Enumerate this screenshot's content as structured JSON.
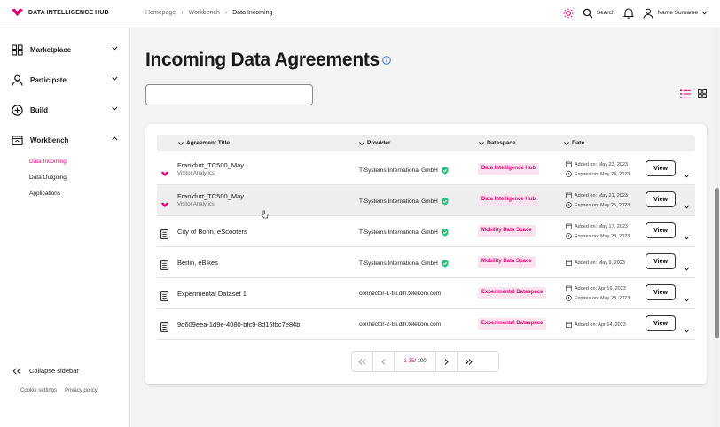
{
  "app": {
    "logo_text": "DATA INTELLIGENCE HUB",
    "accent": "#e20074"
  },
  "breadcrumb": [
    "Homepage",
    "Workbench",
    "Data Incoming"
  ],
  "topbar": {
    "search_label": "Search",
    "user_name": "Name Surname"
  },
  "sidebar": {
    "items": [
      {
        "label": "Marketplace",
        "icon": "grid-icon"
      },
      {
        "label": "Participate",
        "icon": "user-icon"
      },
      {
        "label": "Build",
        "icon": "plus-circle-icon"
      },
      {
        "label": "Workbench",
        "icon": "workbench-icon"
      }
    ],
    "subitems": [
      "Data Incoming",
      "Data Outgoing",
      "Applications"
    ],
    "collapse_label": "Collapse sidebar",
    "footer_links": [
      "Cookie settings",
      "Privacy policy"
    ]
  },
  "page": {
    "title": "Incoming Data Agreements",
    "search_value": ""
  },
  "table": {
    "headers": [
      "Agreement Title",
      "Provider",
      "Dataspace",
      "Date"
    ],
    "view_label": "View",
    "rows": [
      {
        "title": "Frankfurt_TC500_May",
        "subtitle": "Visitor Analytics",
        "provider": "T-Systems International GmbH",
        "verified": true,
        "dataspace": "Data Intelligence Hub",
        "added": "Added on: May 23, 2023",
        "expires": "Expires on: May 24, 2023",
        "icon": "dih-logo-icon"
      },
      {
        "title": "Frankfurt_TC500_May",
        "subtitle": "Visitor Analytics",
        "provider": "T-Systems International GmbH",
        "verified": true,
        "dataspace": "Data Intelligence Hub",
        "added": "Added on: May 21, 2023",
        "expires": "Expires on: May 25, 2023",
        "icon": "dih-logo-icon"
      },
      {
        "title": "City of Bonn, eScooters",
        "subtitle": "",
        "provider": "T-Systems International GmbH",
        "verified": true,
        "dataspace": "Mobility Data Space",
        "added": "Added on: May 17, 2023",
        "expires": "Expires on: May 23, 2023",
        "icon": "document-icon"
      },
      {
        "title": "Berlin, eBikes",
        "subtitle": "",
        "provider": "T-Systems International GmbH",
        "verified": true,
        "dataspace": "Mobility Data Space",
        "added": "Added on: May 9, 2023",
        "expires": "",
        "icon": "document-icon"
      },
      {
        "title": "Experimental Dataset 1",
        "subtitle": "",
        "provider": "connector-1-tsi.dih.telekom.com",
        "verified": false,
        "dataspace": "Experimental Dataspace",
        "added": "Added on: Apr 16, 2023",
        "expires": "Expires on: May 23, 2023",
        "icon": "document-icon"
      },
      {
        "title": "9d609eea-1d9e-4080-bfc9-8d16fbc7e84b",
        "subtitle": "",
        "provider": "connector-2-tsi.dih.telekom.com",
        "verified": false,
        "dataspace": "Experimental Dataspace",
        "added": "Added on: Apr 14, 2023",
        "expires": "",
        "icon": "document-icon"
      }
    ]
  },
  "pagination": {
    "range": "1-35",
    "total": "/ 100"
  }
}
